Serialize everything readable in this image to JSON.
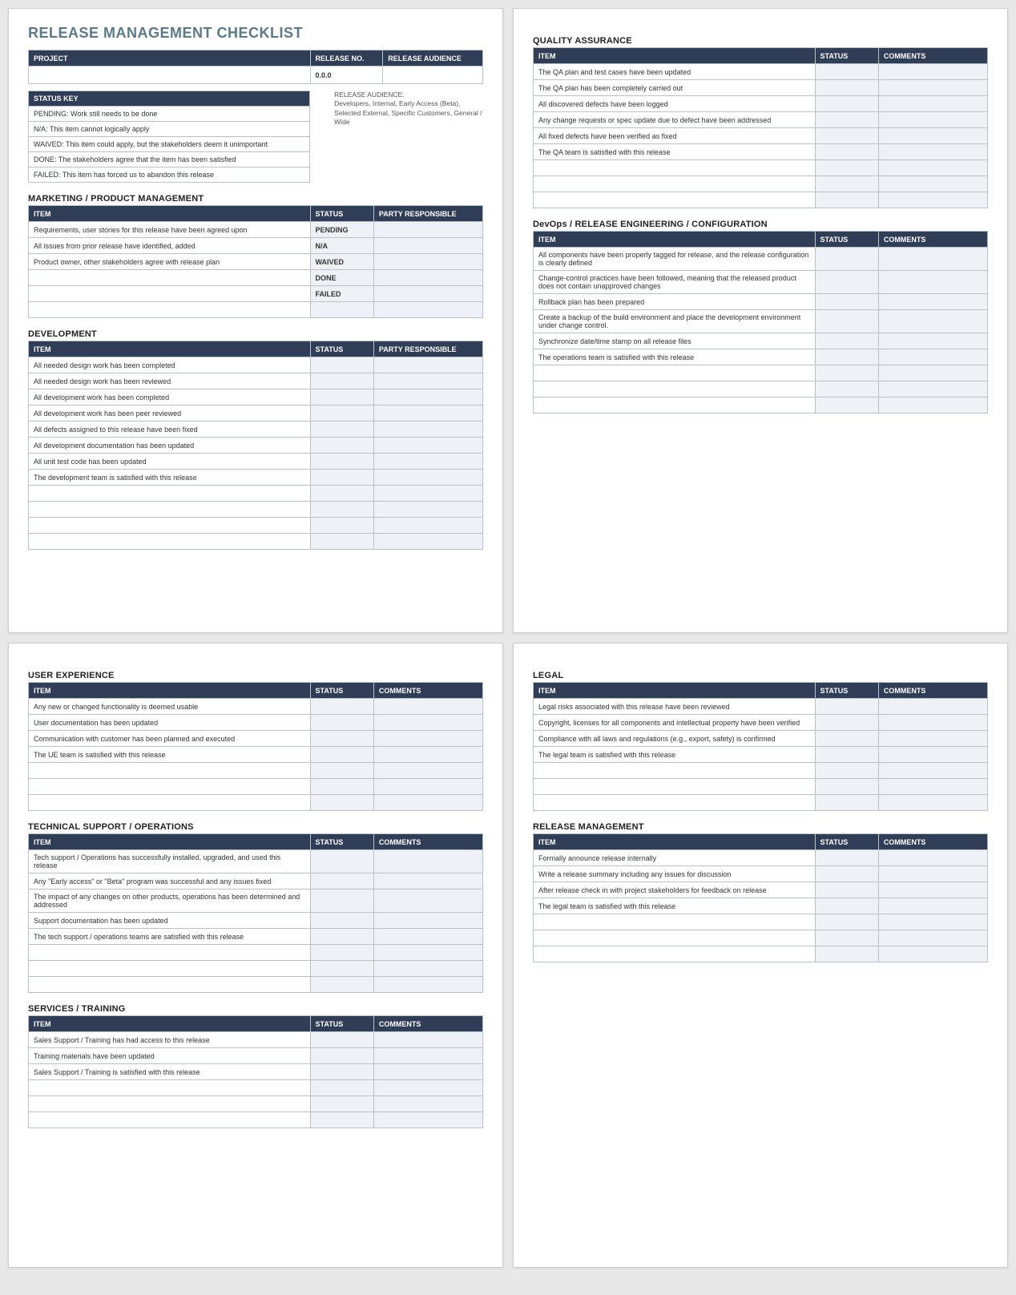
{
  "doc_title": "RELEASE MANAGEMENT CHECKLIST",
  "header_table": {
    "col_project": "PROJECT",
    "col_release_no": "RELEASE NO.",
    "col_release_audience": "RELEASE AUDIENCE",
    "release_no_value": "0.0.0",
    "project_value": "",
    "audience_value": ""
  },
  "status_key": {
    "header": "STATUS KEY",
    "rows": [
      "PENDING:  Work still needs to be done",
      "N/A:  This item cannot logically apply",
      "WAIVED:  This item could apply, but the stakeholders deem it unimportant",
      "DONE:  The stakeholders agree that the item has been satisfied",
      "FAILED:  This item has forced us to abandon this release"
    ]
  },
  "release_audience_note_label": "RELEASE AUDIENCE:",
  "release_audience_note_text": "Developers, Internal, Early Access (Beta), Selected External, Specific Customers, General / Wide",
  "col_labels": {
    "item": "ITEM",
    "status": "STATUS",
    "party": "PARTY RESPONSIBLE",
    "comments": "COMMENTS"
  },
  "sections": {
    "marketing": {
      "title": "MARKETING / PRODUCT MANAGEMENT",
      "third": "party",
      "rows": [
        {
          "item": "Requirements, user stories for this release have been agreed upon",
          "status": "PENDING"
        },
        {
          "item": "All issues from prior release have identified, added",
          "status": "N/A"
        },
        {
          "item": "Product owner, other stakeholders agree with release plan",
          "status": "WAIVED"
        },
        {
          "item": "",
          "status": "DONE"
        },
        {
          "item": "",
          "status": "FAILED"
        },
        {
          "item": "",
          "status": ""
        }
      ]
    },
    "development": {
      "title": "DEVELOPMENT",
      "third": "party",
      "rows": [
        {
          "item": "All needed design work has been completed",
          "status": ""
        },
        {
          "item": "All needed design work has been reviewed",
          "status": ""
        },
        {
          "item": "All development work has been completed",
          "status": ""
        },
        {
          "item": "All development work has been peer reviewed",
          "status": ""
        },
        {
          "item": "All defects assigned to this release have been fixed",
          "status": ""
        },
        {
          "item": "All development documentation has been updated",
          "status": ""
        },
        {
          "item": "All unit test code has been updated",
          "status": ""
        },
        {
          "item": "The development team is satisfied with this release",
          "status": ""
        },
        {
          "item": "",
          "status": ""
        },
        {
          "item": "",
          "status": ""
        },
        {
          "item": "",
          "status": ""
        },
        {
          "item": "",
          "status": ""
        }
      ]
    },
    "qa": {
      "title": "QUALITY ASSURANCE",
      "third": "comments",
      "rows": [
        {
          "item": "The QA plan and test cases have been updated",
          "status": ""
        },
        {
          "item": "The QA plan has been completely carried out",
          "status": ""
        },
        {
          "item": "All discovered defects have been logged",
          "status": ""
        },
        {
          "item": "Any change requests or spec update due to defect have been addressed",
          "status": ""
        },
        {
          "item": "All fixed defects have been verified as fixed",
          "status": ""
        },
        {
          "item": "The QA team is satisfied with this release",
          "status": ""
        },
        {
          "item": "",
          "status": ""
        },
        {
          "item": "",
          "status": ""
        },
        {
          "item": "",
          "status": ""
        }
      ]
    },
    "devops": {
      "title": "DevOps / RELEASE ENGINEERING / CONFIGURATION",
      "third": "comments",
      "rows": [
        {
          "item": "All components have been properly tagged for release, and the release configuration is clearly defined",
          "status": ""
        },
        {
          "item": "Change-control practices have been followed, meaning that the released product does not contain unapproved changes",
          "status": ""
        },
        {
          "item": "Rollback plan has been prepared",
          "status": ""
        },
        {
          "item": "Create a backup of the build environment and place the development environment under change control.",
          "status": ""
        },
        {
          "item": "Synchronize date/time stamp on all release files",
          "status": ""
        },
        {
          "item": "The operations team is satisfied with this release",
          "status": ""
        },
        {
          "item": "",
          "status": ""
        },
        {
          "item": "",
          "status": ""
        },
        {
          "item": "",
          "status": ""
        }
      ]
    },
    "ux": {
      "title": "USER EXPERIENCE",
      "third": "comments",
      "rows": [
        {
          "item": "Any new or changed functionality is deemed usable",
          "status": ""
        },
        {
          "item": "User documentation has been updated",
          "status": ""
        },
        {
          "item": "Communication with customer has been planned and executed",
          "status": ""
        },
        {
          "item": "The UE team is satisfied with this release",
          "status": ""
        },
        {
          "item": "",
          "status": ""
        },
        {
          "item": "",
          "status": ""
        },
        {
          "item": "",
          "status": ""
        }
      ]
    },
    "tech": {
      "title": "TECHNICAL SUPPORT / OPERATIONS",
      "third": "comments",
      "rows": [
        {
          "item": "Tech support / Operations has successfully installed, upgraded, and used this release",
          "status": ""
        },
        {
          "item": "Any \"Early access\" or \"Beta\" program was successful and any issues fixed",
          "status": ""
        },
        {
          "item": "The impact of any changes on other products, operations has been determined and addressed",
          "status": ""
        },
        {
          "item": "Support documentation has been updated",
          "status": ""
        },
        {
          "item": "The tech support / operations teams are satisfied with this release",
          "status": ""
        },
        {
          "item": "",
          "status": ""
        },
        {
          "item": "",
          "status": ""
        },
        {
          "item": "",
          "status": ""
        }
      ]
    },
    "services": {
      "title": "SERVICES / TRAINING",
      "third": "comments",
      "rows": [
        {
          "item": "Sales Support / Training has had access to this release",
          "status": ""
        },
        {
          "item": "Training materials have been updated",
          "status": ""
        },
        {
          "item": "Sales Support / Training is satisfied with this release",
          "status": ""
        },
        {
          "item": "",
          "status": ""
        },
        {
          "item": "",
          "status": ""
        },
        {
          "item": "",
          "status": ""
        }
      ]
    },
    "legal": {
      "title": "LEGAL",
      "third": "comments",
      "rows": [
        {
          "item": "Legal risks associated with this release have been reviewed",
          "status": ""
        },
        {
          "item": "Copyright, licenses for all components and intellectual property have been verified",
          "status": ""
        },
        {
          "item": "Compliance with all laws and regulations (e.g., export, safety) is confirmed",
          "status": ""
        },
        {
          "item": "The legal team is satisfied with this release",
          "status": ""
        },
        {
          "item": "",
          "status": ""
        },
        {
          "item": "",
          "status": ""
        },
        {
          "item": "",
          "status": ""
        }
      ]
    },
    "release_mgmt": {
      "title": "RELEASE MANAGEMENT",
      "third": "comments",
      "rows": [
        {
          "item": "Formally announce release internally",
          "status": ""
        },
        {
          "item": "Write a release summary including any issues for discussion",
          "status": ""
        },
        {
          "item": "After release check in with project stakeholders for feedback on release",
          "status": ""
        },
        {
          "item": "The legal team is satisfied with this release",
          "status": ""
        },
        {
          "item": "",
          "status": ""
        },
        {
          "item": "",
          "status": ""
        },
        {
          "item": "",
          "status": ""
        }
      ]
    }
  }
}
